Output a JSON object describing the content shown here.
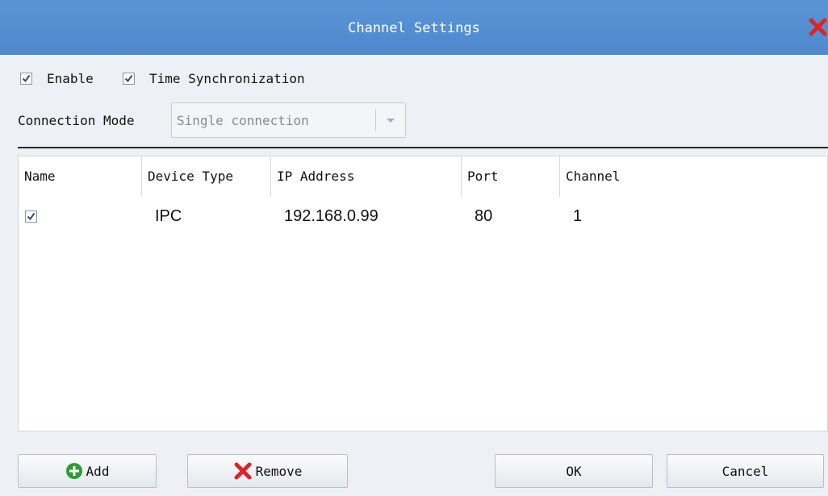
{
  "window": {
    "title": "Channel Settings"
  },
  "options": {
    "enable_label": "Enable",
    "enable_checked": true,
    "time_sync_label": "Time Synchronization",
    "time_sync_checked": true
  },
  "connection_mode": {
    "label": "Connection Mode",
    "value": "Single connection"
  },
  "table": {
    "columns": [
      "Name",
      "Device Type",
      "IP Address",
      "Port",
      "Channel"
    ],
    "rows": [
      {
        "checked": true,
        "name": "",
        "device_type": "IPC",
        "ip": "192.168.0.99",
        "port": "80",
        "channel": "1"
      }
    ]
  },
  "buttons": {
    "add": "Add",
    "remove": "Remove",
    "ok": "OK",
    "cancel": "Cancel"
  },
  "colors": {
    "titlebar": "#5b95d6",
    "close": "#d8262b",
    "add_icon": "#2f9a3a",
    "remove_icon": "#d8262b"
  }
}
